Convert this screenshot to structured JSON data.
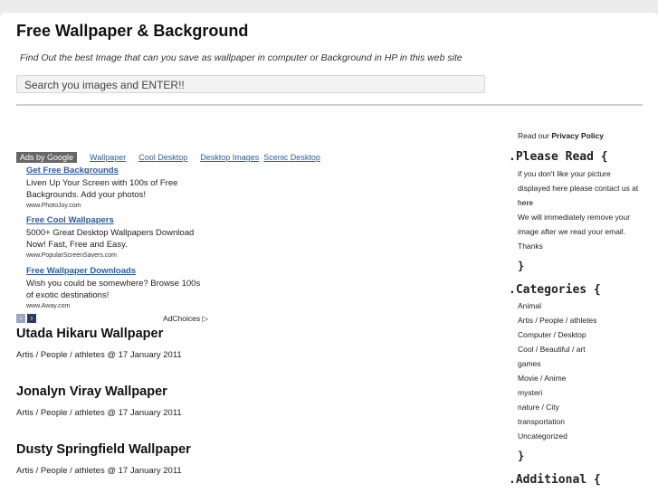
{
  "header": {
    "title": "Free Wallpaper & Background",
    "tagline": "Find Out the best Image that can you save as wallpaper in computer or Background in HP in this web site",
    "search_value": "Search you images and ENTER!!"
  },
  "ads": {
    "badge": "Ads by Google",
    "links": [
      "Wallpaper",
      "Cool Desktop",
      "Desktop Images",
      "Scenic Desktop"
    ],
    "items": [
      {
        "title": "Get Free Backgrounds",
        "body": "Liven Up Your Screen with 100s of Free Backgrounds. Add your photos!",
        "url": "www.PhotoJoy.com"
      },
      {
        "title": "Free Cool Wallpapers",
        "body": "5000+ Great Desktop Wallpapers Download Now! Fast, Free and Easy.",
        "url": "www.PopularScreenSavers.com"
      },
      {
        "title": "Free Wallpaper Downloads",
        "body": "Wish you could be somewhere? Browse 100s of exotic destinations!",
        "url": "www.Away.com"
      }
    ],
    "adchoices": "AdChoices ▷"
  },
  "posts": [
    {
      "title": "Utada Hikaru Wallpaper",
      "meta": "Artis / People / athletes @ 17 January 2011"
    },
    {
      "title": "Jonalyn Viray Wallpaper",
      "meta": "Artis / People / athletes @ 17 January 2011"
    },
    {
      "title": "Dusty Springfield Wallpaper",
      "meta": "Artis / People / athletes @ 17 January 2011"
    }
  ],
  "sidebar": {
    "read_our": "Read our",
    "privacy_link": "Privacy Policy",
    "please_read_heading": ".Please Read {",
    "please_read_text_1": "if you don't like your picture displayed here please contact us at",
    "here_link": "here",
    "please_read_text_2": "We will immediately remove your image after we read your email. Thanks",
    "close_brace": "}",
    "categories_heading": ".Categories {",
    "categories": [
      "Animal",
      "Artis / People / athletes",
      "Computer / Desktop",
      "Cool / Beautiful / art",
      "games",
      "Movie / Anime",
      "mysteri",
      "nature / City",
      "transportation",
      "Uncategorized"
    ],
    "additional_heading": ".Additional {"
  }
}
